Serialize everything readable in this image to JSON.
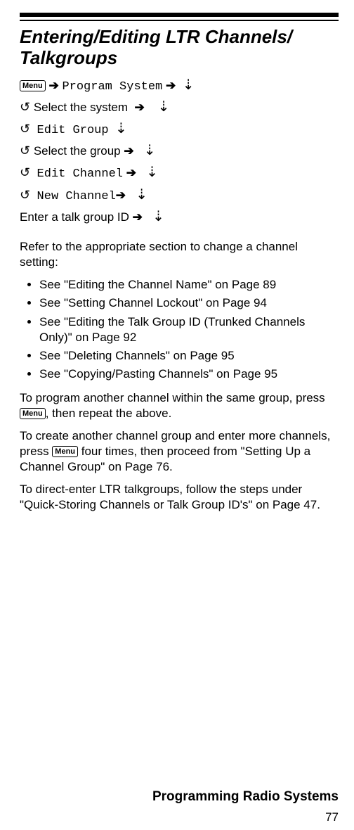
{
  "menu_label": "Menu",
  "heading": "Entering/Editing LTR Channels/ Talkgroups",
  "steps": {
    "s1_program": "Program System",
    "s2_select_system": "Select the system",
    "s3_edit_group": "Edit Group",
    "s4_select_group": "Select the group",
    "s5_edit_channel": "Edit Channel",
    "s6_new_channel": "New Channel",
    "s7_enter_id": "Enter a talk group ID"
  },
  "refer_intro": "Refer to the appropriate section to change a channel setting:",
  "bullets": [
    "See \"Editing the Channel Name\" on Page 89",
    "See \"Setting Channel Lockout\" on Page 94",
    "See \"Editing the Talk Group ID (Trunked Channels Only)\" on Page 92",
    "See \"Deleting Channels\" on Page 95",
    "See \"Copying/Pasting Channels\" on Page 95"
  ],
  "para_another_channel_pre": "To program another channel within the same group, press ",
  "para_another_channel_post": ", then repeat the above.",
  "para_another_group_pre": "To create another channel group and enter more channels, press ",
  "para_another_group_post": " four times, then proceed from \"Setting Up a Channel Group\" on Page 76.",
  "para_direct_enter": "To direct-enter LTR talkgroups, follow the steps under \"Quick-Storing Channels or Talk Group ID's\" on Page 47.",
  "footer": "Programming Radio Systems",
  "page_number": "77"
}
